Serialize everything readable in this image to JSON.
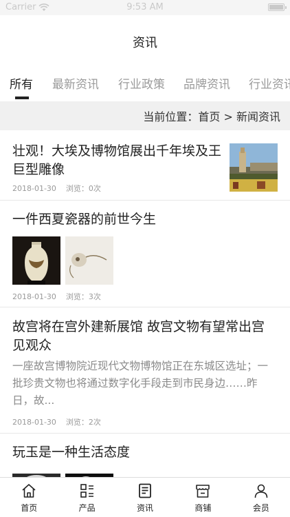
{
  "status_bar": {
    "carrier": "Carrier",
    "time": "9:53 AM",
    "battery_level": 1.0
  },
  "nav": {
    "title": "资讯"
  },
  "tabs": [
    {
      "label": "所有",
      "active": true
    },
    {
      "label": "最新资讯",
      "active": false
    },
    {
      "label": "行业政策",
      "active": false
    },
    {
      "label": "品牌资讯",
      "active": false
    },
    {
      "label": "行业资讯",
      "active": false
    }
  ],
  "location": {
    "text": "当前位置：首页 > 新闻资讯"
  },
  "articles": [
    {
      "title": "壮观！大埃及博物馆展出千年埃及王巨型雕像",
      "date": "2018-01-30",
      "views": "浏览：0次"
    },
    {
      "title": "一件西夏瓷器的前世今生",
      "date": "2018-01-30",
      "views": "浏览：3次"
    },
    {
      "title": "故宫将在宫外建新展馆 故宫文物有望常出宫见观众",
      "summary": "一座故宫博物院近现代文物博物馆正在东城区选址；一批珍贵文物也将通过数字化手段走到市民身边……昨日，故...",
      "date": "2018-01-30",
      "views": "浏览：2次"
    },
    {
      "title": "玩玉是一种生活态度"
    }
  ],
  "tabbar": [
    {
      "label": "首页",
      "icon": "home-icon"
    },
    {
      "label": "产品",
      "icon": "grid-list-icon"
    },
    {
      "label": "资讯",
      "icon": "news-icon"
    },
    {
      "label": "商铺",
      "icon": "store-icon"
    },
    {
      "label": "会员",
      "icon": "user-icon"
    }
  ]
}
